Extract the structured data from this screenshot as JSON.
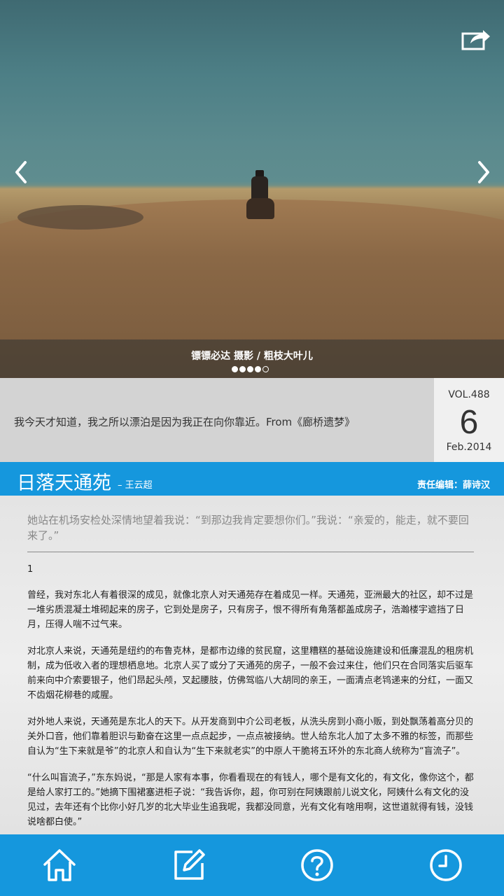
{
  "hero": {
    "caption": "镖镖必达 摄影 / 粗枝大叶儿",
    "slide_count": 5,
    "active_slide": 4,
    "icons": {
      "share": "share-icon",
      "prev": "chevron-left-icon",
      "next": "chevron-right-icon"
    }
  },
  "quote": {
    "text": "我今天才知道，我之所以漂泊是因为我正在向你靠近。From《廊桥遗梦》"
  },
  "date": {
    "vol": "VOL.488",
    "day": "6",
    "month": "Feb.2014"
  },
  "article": {
    "title": "日落天通苑",
    "author": "– 王云超",
    "editor": "责任编辑：薛诗汉",
    "lead": "她站在机场安检处深情地望着我说：“到那边我肯定要想你们。”我说：“亲爱的，能走，就不要回来了。”",
    "section_number": "1",
    "paragraphs": [
      "曾经，我对东北人有着很深的成见，就像北京人对天通苑存在着成见一样。天通苑，亚洲最大的社区，却不过是一堆劣质混凝土堆砌起来的房子，它到处是房子，只有房子，恨不得所有角落都盖成房子，浩瀚楼宇遮挡了日月，压得人喘不过气来。",
      "对北京人来说，天通苑是纽约的布鲁克林，是都市边缘的贫民窟，这里糟糕的基础设施建设和低廉混乱的租房机制，成为低收入者的理想栖息地。北京人买了或分了天通苑的房子，一般不会过来住，他们只在合同落实后驱车前来向中介索要银子，他们昂起头颅，叉起腰肢，仿佛驾临八大胡同的亲王，一面清点老鸨递来的分红，一面又不齿烟花柳巷的咸腥。",
      "对外地人来说，天通苑是东北人的天下。从开发商到中介公司老板，从洗头房到小商小贩，到处飘荡着高分贝的关外口音，他们靠着胆识与勤奋在这里一点点起步，一点点被接纳。世人给东北人加了太多不雅的标签，而那些自认为“生下来就是爷”的北京人和自认为“生下来就老实”的中原人干脆将五环外的东北商人统称为“盲流子”。",
      "“什么叫盲流子，”东东妈说，“那是人家有本事，你看看现在的有钱人，哪个是有文化的，有文化，像你这个，都是给人家打工的。”她摘下围裙塞进柜子说：“我告诉你，超，你可别在阿姨跟前儿说文化，阿姨什么有文化的没见过，去年还有个比你小好几岁的北大毕业生追我呢，我都没同意，光有文化有啥用啊，这世道就得有钱，没钱说啥都白使。”"
    ]
  },
  "bottom_nav": [
    {
      "name": "home",
      "icon": "home-icon"
    },
    {
      "name": "compose",
      "icon": "edit-icon"
    },
    {
      "name": "help",
      "icon": "question-icon"
    },
    {
      "name": "history",
      "icon": "clock-icon"
    }
  ],
  "colors": {
    "accent": "#1597dd",
    "quote_bg": "#d3d3d3",
    "date_bg": "#f0f0f0"
  }
}
